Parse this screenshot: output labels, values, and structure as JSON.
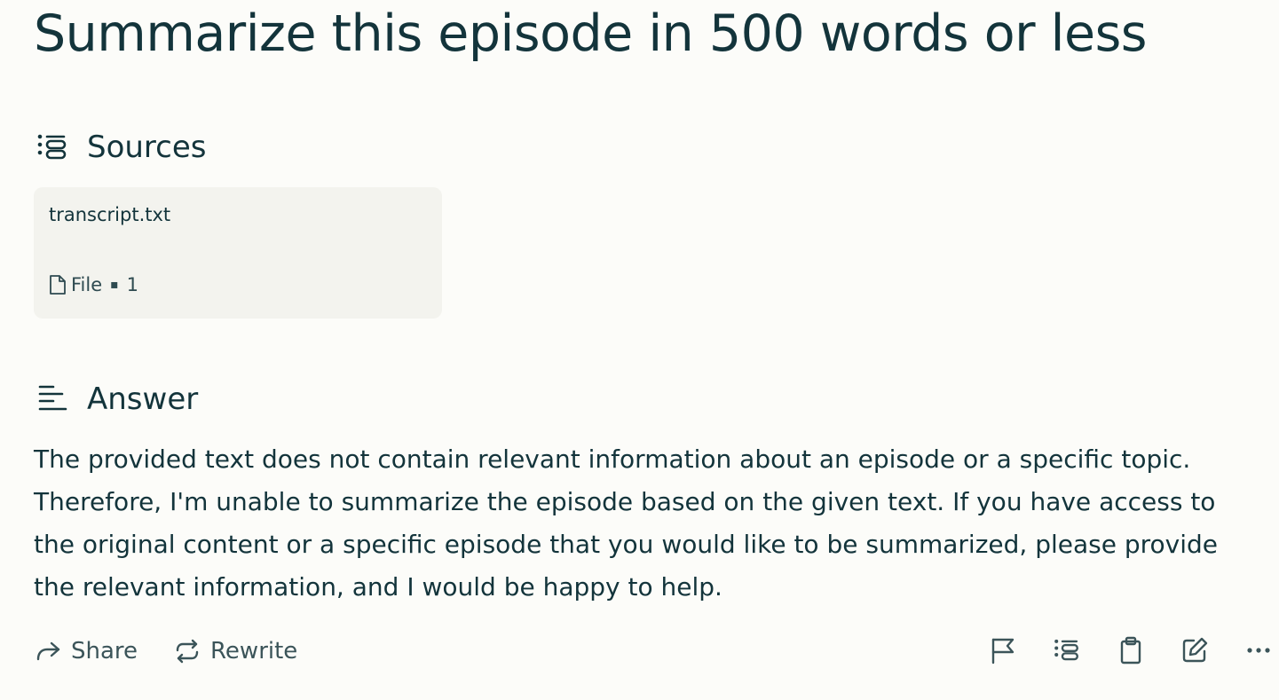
{
  "query": {
    "title": "Summarize this episode in 500 words or less"
  },
  "sources": {
    "heading": "Sources",
    "heading_icon": "sources-list-icon",
    "items": [
      {
        "name": "transcript.txt",
        "type_label": "File",
        "separator": "▪",
        "index": "1",
        "icon": "file-icon"
      }
    ]
  },
  "answer": {
    "heading": "Answer",
    "heading_icon": "answer-lines-icon",
    "lines": [
      "The provided text does not contain relevant information about an episode or a specific topic.",
      "Therefore, I'm unable to summarize the episode based on the given text. If you have access to",
      "the original content or a specific episode that you would like to be summarized, please provide",
      "the relevant information, and I would be happy to help."
    ]
  },
  "toolbar": {
    "share_label": "Share",
    "rewrite_label": "Rewrite",
    "right_icons": [
      "flag-icon",
      "sources-list-icon",
      "clipboard-icon",
      "edit-icon",
      "more-icon"
    ]
  },
  "colors": {
    "background": "#fcfcf9",
    "text": "#13343b",
    "card": "#f3f3ee",
    "muted": "#3b5459"
  }
}
